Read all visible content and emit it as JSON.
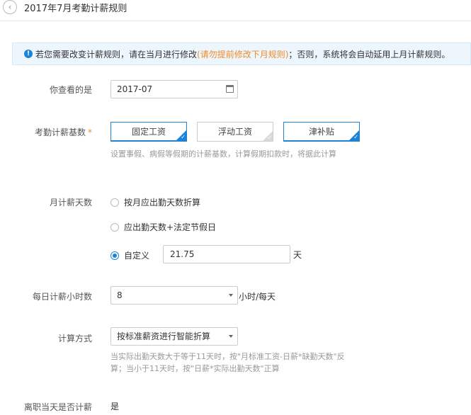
{
  "header": {
    "back_icon": "chevron-left-icon",
    "title": "2017年7月考勤计薪规则"
  },
  "notice": {
    "icon": "info-icon",
    "text_before": "若您需要改变计薪规则，请在当月进行修改",
    "warn_text": "(请勿提前修改下月规则)",
    "text_after": "；否则，系统将会自动延用上月计薪规则。",
    "accent_color": "#1e83d6",
    "warn_color": "#f08a28"
  },
  "view_month": {
    "label": "你查看的是",
    "value": "2017-07",
    "icon": "calendar-icon"
  },
  "salary_base": {
    "label": "考勤计薪基数",
    "required_mark": "*",
    "options": [
      {
        "label": "固定工资",
        "selected": true
      },
      {
        "label": "浮动工资",
        "selected": false
      },
      {
        "label": "津补贴",
        "selected": true
      }
    ],
    "hint": "设置事假、病假等假期的计薪基数，计算假期扣款时，将据此计算"
  },
  "monthly_days": {
    "label": "月计薪天数",
    "options": [
      {
        "label": "按月应出勤天数折算",
        "checked": false
      },
      {
        "label": "应出勤天数+法定节假日",
        "checked": false
      },
      {
        "label": "自定义",
        "checked": true
      }
    ],
    "custom_value": "21.75",
    "custom_unit": "天"
  },
  "daily_hours": {
    "label": "每日计薪小时数",
    "value": "8",
    "unit": "小时/每天"
  },
  "calc_method": {
    "label": "计算方式",
    "value": "按标准薪资进行智能折算",
    "hint_line1": "当实际出勤天数大于等于11天时，按\"月标准工资-日薪*缺勤天数\"反",
    "hint_line2": "算；当小于11天时，按\"日薪*实际出勤天数\"正算"
  },
  "leave_day": {
    "label": "离职当天是否计薪",
    "value": "是"
  }
}
